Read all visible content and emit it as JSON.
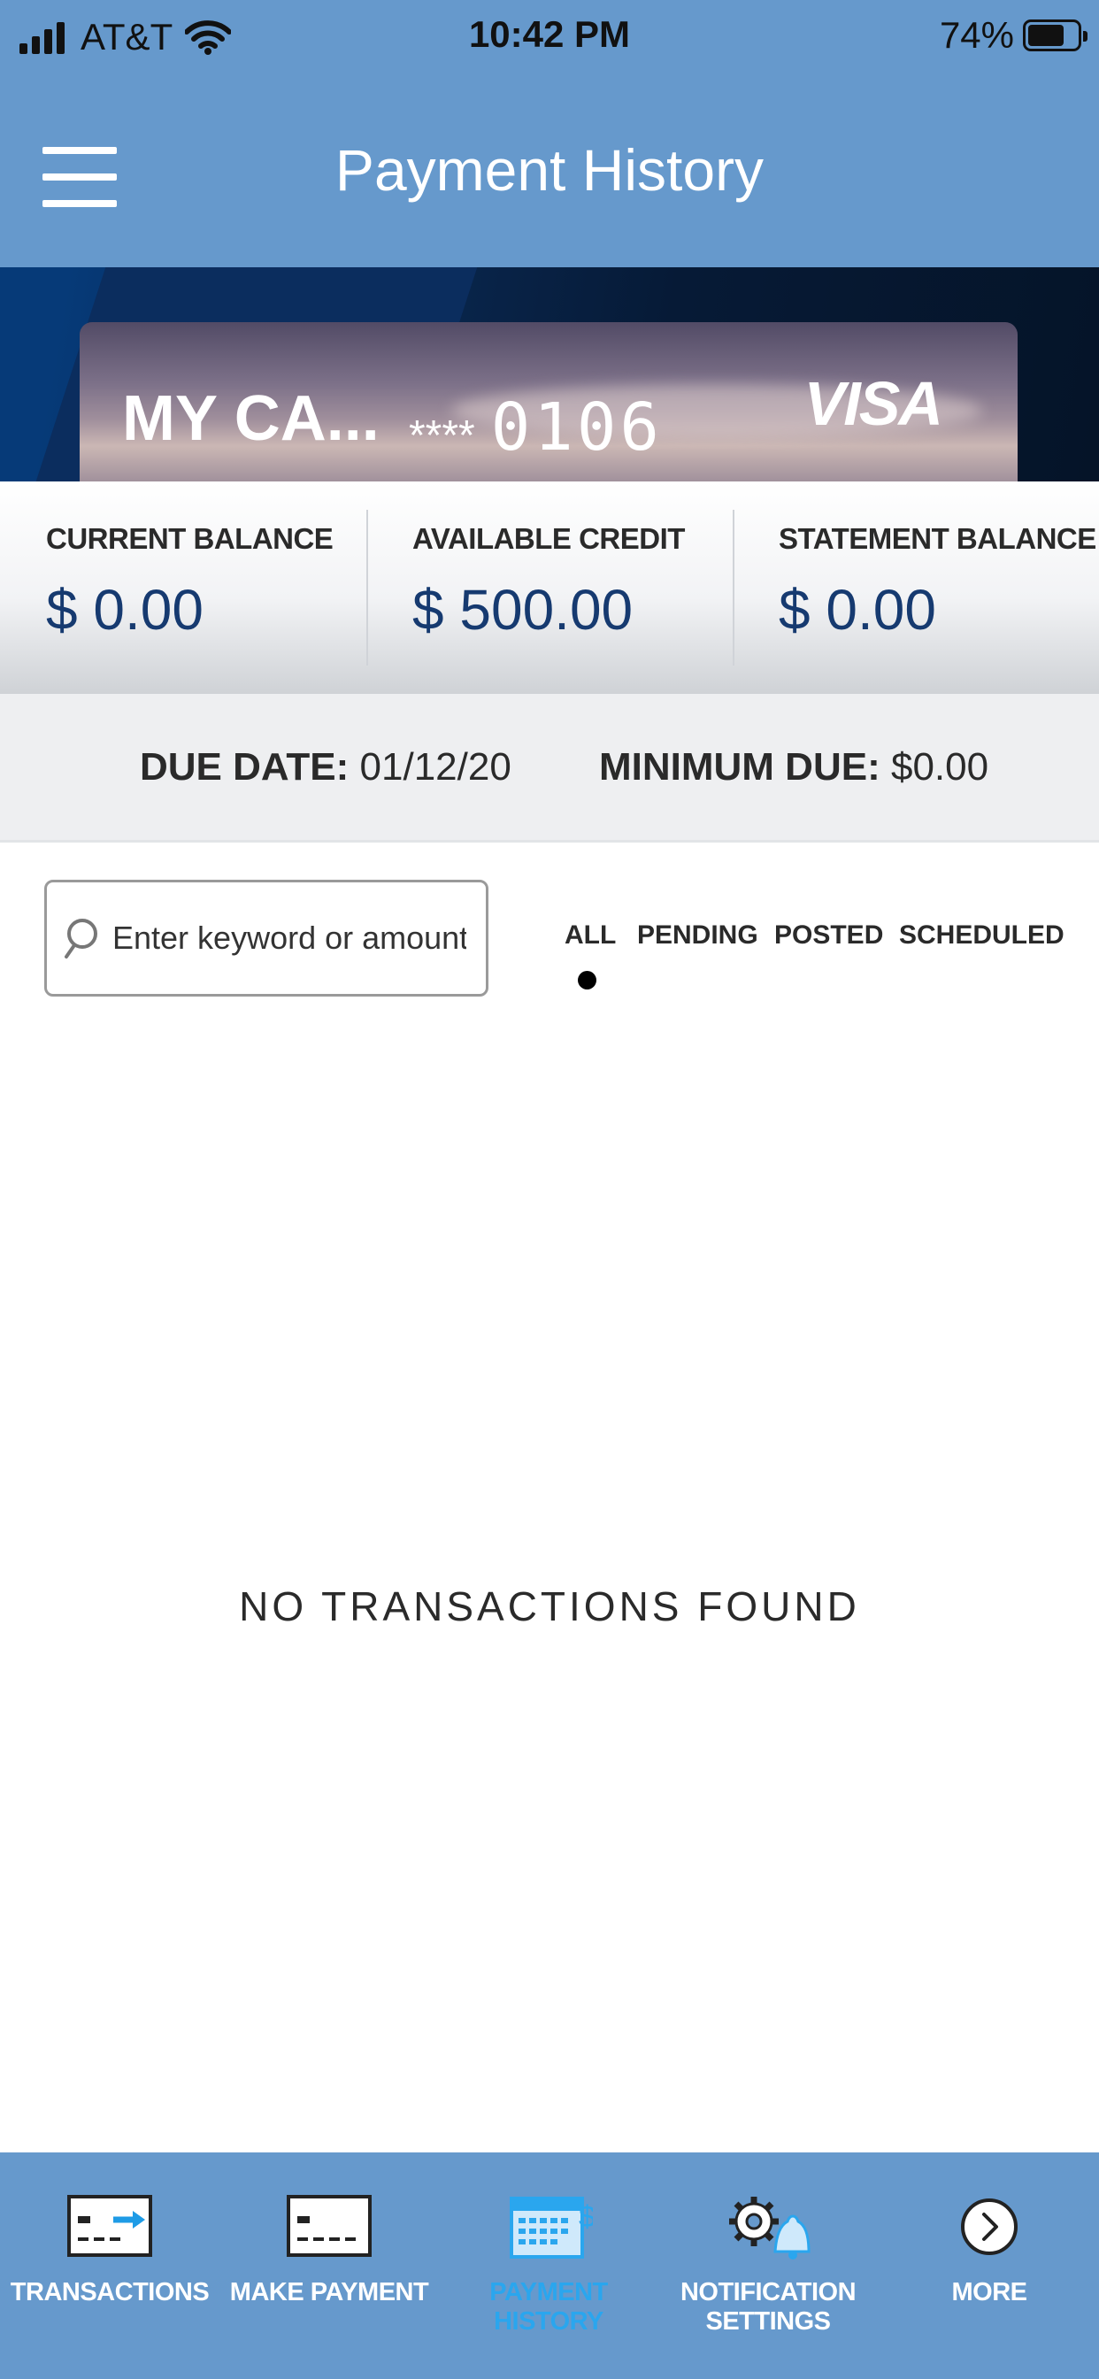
{
  "status_bar": {
    "carrier": "AT&T",
    "time": "10:42 PM",
    "battery": "74%"
  },
  "header": {
    "title": "Payment History"
  },
  "card": {
    "name": "MY CA...",
    "mask": "****",
    "last4": "0106",
    "brand": "VISA"
  },
  "balances": [
    {
      "label": "CURRENT BALANCE",
      "value": "$ 0.00"
    },
    {
      "label": "AVAILABLE CREDIT",
      "value": "$ 500.00"
    },
    {
      "label": "STATEMENT BALANCE",
      "value": "$ 0.00"
    }
  ],
  "due": {
    "date_label": "DUE DATE:",
    "date_value": "01/12/20",
    "min_label": "MINIMUM DUE:",
    "min_value": "$0.00"
  },
  "search": {
    "placeholder": "Enter keyword or amount"
  },
  "filters": {
    "all": "ALL",
    "pending": "PENDING",
    "posted": "POSTED",
    "scheduled": "SCHEDULED",
    "active": "ALL"
  },
  "empty_message": "NO TRANSACTIONS FOUND",
  "tabs": [
    {
      "label_line1": "TRANSACTIONS",
      "label_line2": "",
      "icon": "transactions-icon"
    },
    {
      "label_line1": "MAKE PAYMENT",
      "label_line2": "",
      "icon": "make-payment-icon"
    },
    {
      "label_line1": "PAYMENT",
      "label_line2": "HISTORY",
      "icon": "payment-history-icon",
      "active": true
    },
    {
      "label_line1": "NOTIFICATION",
      "label_line2": "SETTINGS",
      "icon": "notification-settings-icon"
    },
    {
      "label_line1": "MORE",
      "label_line2": "",
      "icon": "more-icon"
    }
  ],
  "colors": {
    "header_bg": "#6699cc",
    "balance_value": "#163a70",
    "tab_active": "#2aa6ee"
  }
}
